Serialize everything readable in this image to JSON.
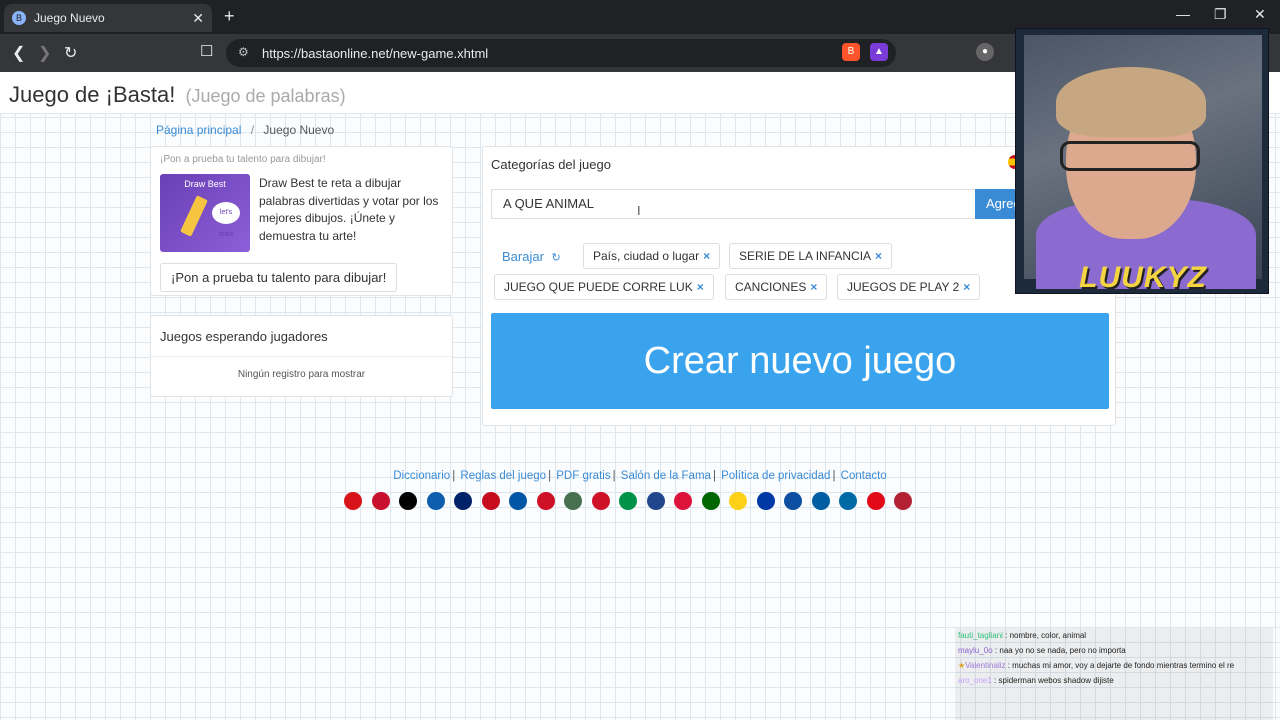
{
  "browser": {
    "tab_title": "Juego Nuevo",
    "url": "https://bastaonline.net/new-game.xhtml"
  },
  "site": {
    "title": "Juego de ¡Basta!",
    "subtitle": "(Juego de palabras)"
  },
  "breadcrumb": {
    "home": "Página principal",
    "current": "Juego Nuevo"
  },
  "promo": {
    "heading": "¡Pon a prueba tu talento para dibujar!",
    "thumb_label": "Draw Best",
    "thumb_bubble": "let's draw",
    "description": "Draw Best te reta a dibujar palabras divertidas y votar por los mejores dibujos. ¡Únete y demuestra tu arte!",
    "button": "¡Pon a prueba tu talento para dibujar!"
  },
  "waiting": {
    "title": "Juegos esperando jugadores",
    "empty": "Ningún registro para mostrar"
  },
  "categories": {
    "title": "Categorías del juego",
    "input_value": "A QUE ANIMAL",
    "add_button": "Agregar",
    "shuffle": "Barajar",
    "chips": [
      "País, ciudad o lugar",
      "SERIE DE LA INFANCIA",
      "JUEGO QUE PUEDE CORRE LUK",
      "CANCIONES",
      "JUEGOS DE PLAY 2"
    ]
  },
  "create_button": "Crear nuevo juego",
  "footer": {
    "links": [
      "Diccionario",
      "Reglas del juego",
      "PDF gratis",
      "Salón de la Fama",
      "Política de privacidad",
      "Contacto"
    ]
  },
  "flags": [
    "#d7141a",
    "#c8102e",
    "#000000",
    "#0d5eaf",
    "#012169",
    "#c60b1e",
    "#0055a4",
    "#ce1126",
    "#477050",
    "#ce1126",
    "#009246",
    "#21468b",
    "#dc143c",
    "#006600",
    "#fcd116",
    "#0039a6",
    "#0b4ea2",
    "#005da4",
    "#006aa7",
    "#e30a17",
    "#b22234"
  ],
  "webcam": {
    "name": "LUUKYZ"
  },
  "chat": [
    {
      "user": "fauti_tagliani",
      "text": ": nombre, color, animal"
    },
    {
      "user": "maylu_0o",
      "text": ": naa yo no se nada, pero no importa"
    },
    {
      "user": "Valentinaliz",
      "text": ": muchas mi amor, voy a dejarte de fondo mientras termino el re"
    },
    {
      "user": "aro_one1",
      "text": ": spiderman webos shadow dijiste"
    }
  ],
  "colors": {
    "primary": "#3a8bd6",
    "create_button": "#3aa3ee"
  }
}
